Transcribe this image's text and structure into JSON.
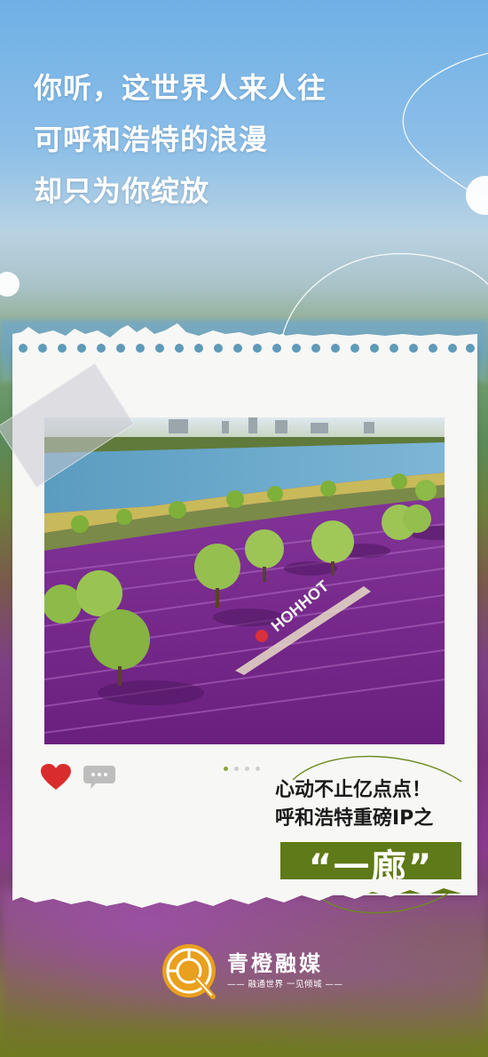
{
  "headline": {
    "lines": [
      "你听，这世界人来人往",
      "可呼和浩特的浪漫",
      "却只为你绽放"
    ]
  },
  "photo": {
    "sign_text": "HOHHOT"
  },
  "post": {
    "like_icon": "heart-icon",
    "comment_icon": "comment-icon",
    "pager": {
      "total": 4,
      "active": 1
    }
  },
  "promo": {
    "line1": "心动不止亿点点！",
    "line2": "呼和浩特重磅IP之",
    "highlight": "“一廊”",
    "highlight_bg": "#5f7a18"
  },
  "brand": {
    "name": "青橙融媒",
    "slogan": "—— 融通世界 一见倾城 ——",
    "accent": "#e9a01d"
  }
}
